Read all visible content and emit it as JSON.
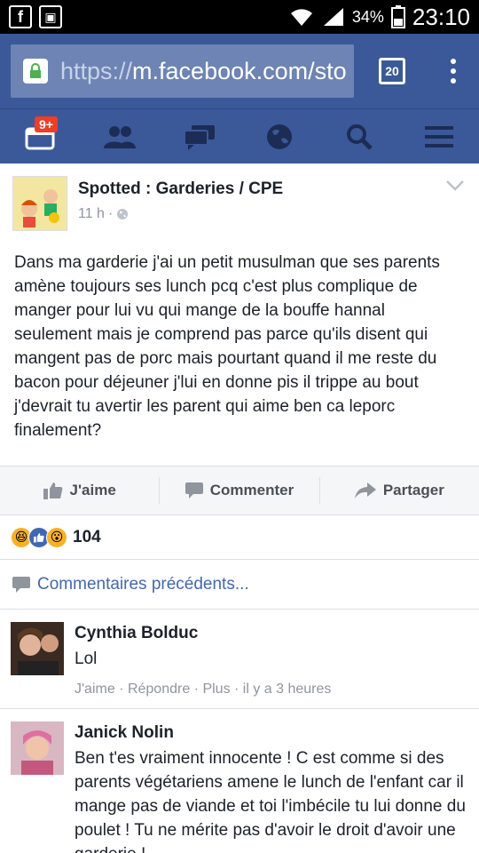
{
  "status_bar": {
    "left_icons": [
      "facebook-icon",
      "image-icon"
    ],
    "battery": "34%",
    "time": "23:10"
  },
  "browser": {
    "url_scheme": "https://",
    "url_host": "m.facebook.com/sto",
    "tab_count": "20"
  },
  "nav": {
    "notifications_badge": "9+",
    "items": [
      "notifications-icon",
      "friends-icon",
      "messages-icon",
      "globe-icon",
      "search-icon",
      "menu-icon"
    ]
  },
  "post": {
    "page_name": "Spotted : Garderies / CPE",
    "time": "11 h",
    "separator": "·",
    "body": "Dans ma garderie j'ai un petit musulman que ses parents amène toujours ses lunch pcq c'est plus complique de manger pour lui vu qui mange de la bouffe hannal seulement mais je comprend pas parce qu'ils disent qui mangent pas de porc mais pourtant quand il me reste du bacon pour déjeuner j'lui en donne pis il trippe au bout j'devrait tu avertir les parent qui aime ben ca leporc finalement?"
  },
  "actions": {
    "like": "J'aime",
    "comment": "Commenter",
    "share": "Partager"
  },
  "reactions": {
    "count": "104"
  },
  "previous_comments": "Commentaires précédents...",
  "comments": [
    {
      "name": "Cynthia Bolduc",
      "text": "Lol",
      "meta": "J'aime · Répondre · Plus · il y a 3 heures"
    },
    {
      "name": "Janick Nolin",
      "text": "Ben t'es vraiment innocente ! C est comme si des parents végétariens amene le lunch de l'enfant car il mange pas de viande et toi l'imbécile tu lui donne du poulet ! Tu ne mérite pas d'avoir le droit d'avoir une garderie !"
    }
  ],
  "colors": {
    "facebook_blue": "#3b5998",
    "link_blue": "#4267b2",
    "badge_red": "#f03d25"
  }
}
